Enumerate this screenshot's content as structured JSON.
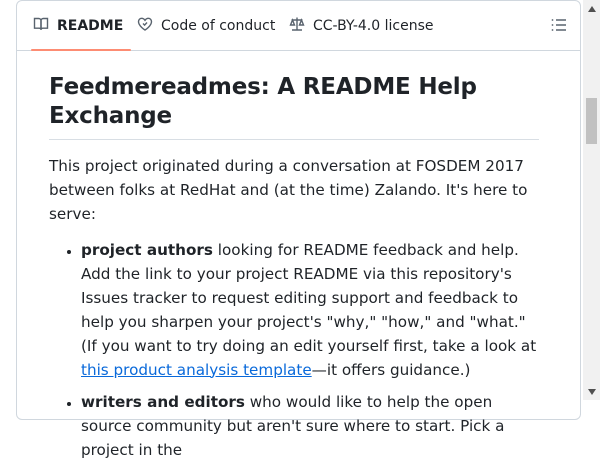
{
  "tabs": [
    {
      "label": "README",
      "icon": "book-icon",
      "active": true
    },
    {
      "label": "Code of conduct",
      "icon": "heart-icon",
      "active": false
    },
    {
      "label": "CC-BY-4.0 license",
      "icon": "law-scale-icon",
      "active": false
    }
  ],
  "toc_icon": "list-unordered-icon",
  "colors": {
    "accent_underline": "#fd8c73",
    "link": "#0969da",
    "text": "#1f2328",
    "border": "#d0d7de"
  },
  "readme": {
    "title": "Feedmereadmes: A README Help Exchange",
    "intro": "This project originated during a conversation at FOSDEM 2017 between folks at RedHat and (at the time) Zalando. It's here to serve:",
    "items": [
      {
        "bold": "project authors",
        "text_before_link": " looking for README feedback and help. Add the link to your project README via this repository's Issues tracker to request editing support and feedback to help you sharpen your project's \"why,\" \"how,\" and \"what.\" (If you want to try doing an edit yourself first, take a look at ",
        "link": "this product analysis template",
        "text_after_link": "—it offers guidance.)"
      },
      {
        "bold": "writers and editors",
        "text": " who would like to help the open source community but aren't sure where to start. Pick a project in the"
      }
    ]
  }
}
